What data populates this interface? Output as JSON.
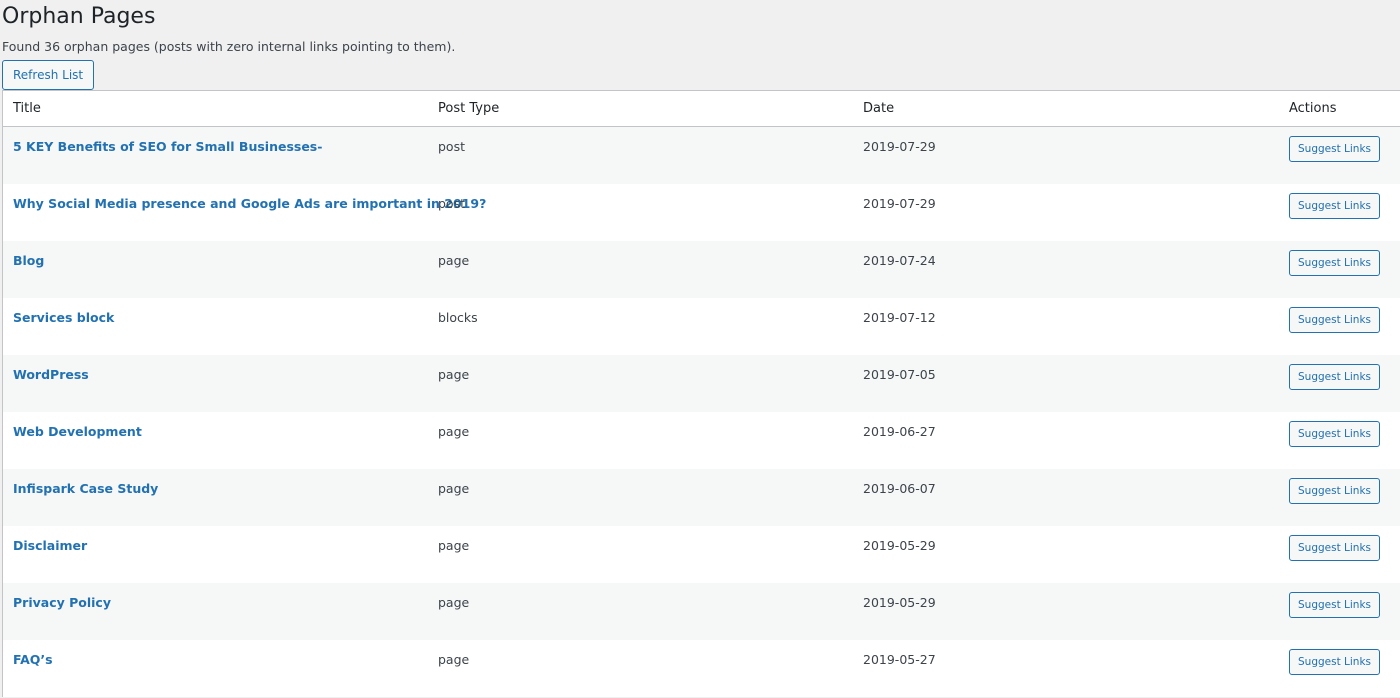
{
  "header": {
    "title": "Orphan Pages",
    "summary": "Found 36 orphan pages (posts with zero internal links pointing to them).",
    "refresh_label": "Refresh List"
  },
  "table": {
    "columns": [
      "Title",
      "Post Type",
      "Date",
      "Actions"
    ],
    "rows": [
      {
        "title": "5 KEY Benefits of SEO for Small Businesses-",
        "type": "post",
        "date": "2019-07-29",
        "action": "Suggest Links"
      },
      {
        "title": "Why Social Media presence and Google Ads are important in 2019?",
        "type": "post",
        "date": "2019-07-29",
        "action": "Suggest Links"
      },
      {
        "title": "Blog",
        "type": "page",
        "date": "2019-07-24",
        "action": "Suggest Links"
      },
      {
        "title": "Services block",
        "type": "blocks",
        "date": "2019-07-12",
        "action": "Suggest Links"
      },
      {
        "title": "WordPress",
        "type": "page",
        "date": "2019-07-05",
        "action": "Suggest Links"
      },
      {
        "title": "Web Development",
        "type": "page",
        "date": "2019-06-27",
        "action": "Suggest Links"
      },
      {
        "title": "Infispark Case Study",
        "type": "page",
        "date": "2019-06-07",
        "action": "Suggest Links"
      },
      {
        "title": "Disclaimer",
        "type": "page",
        "date": "2019-05-29",
        "action": "Suggest Links"
      },
      {
        "title": "Privacy Policy",
        "type": "page",
        "date": "2019-05-29",
        "action": "Suggest Links"
      },
      {
        "title": "FAQ’s",
        "type": "page",
        "date": "2019-05-27",
        "action": "Suggest Links"
      }
    ]
  },
  "colors": {
    "link": "#2271b1",
    "page_bg": "#f0f0f1",
    "row_alt": "#f6f7f7",
    "border": "#c3c4c7"
  }
}
